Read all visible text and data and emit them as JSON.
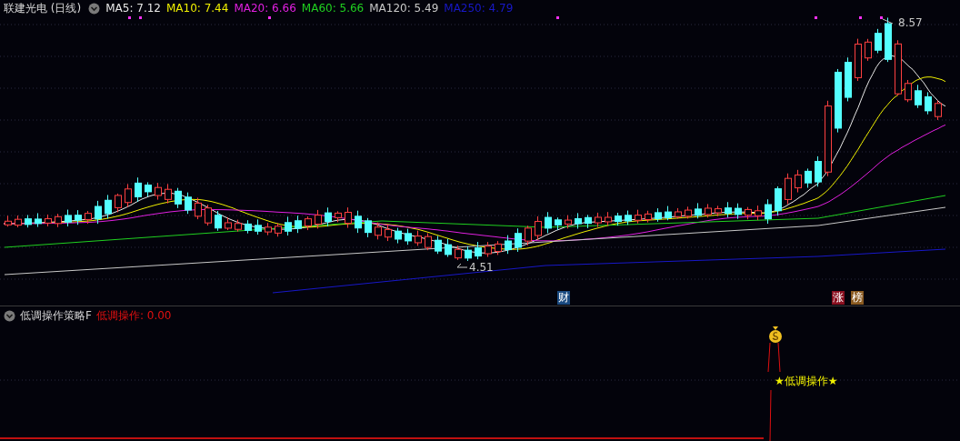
{
  "main_chart": {
    "title": "联建光电 (日线)",
    "ma_legend": [
      {
        "label": "MA5: 7.12",
        "color": "#e8e8e8"
      },
      {
        "label": "MA10: 7.44",
        "color": "#f0f000"
      },
      {
        "label": "MA20: 6.66",
        "color": "#e020e0"
      },
      {
        "label": "MA60: 5.66",
        "color": "#20d020"
      },
      {
        "label": "MA120: 5.49",
        "color": "#c8c8c8"
      },
      {
        "label": "MA250: 4.79",
        "color": "#1818c8"
      }
    ],
    "high_label": "8.57",
    "low_label": "4.51",
    "event_markers": [
      {
        "label": "财",
        "color": "#1a4a80"
      },
      {
        "label": "涨",
        "color": "#8a1020"
      },
      {
        "label": "榜",
        "color": "#8a5a20"
      }
    ]
  },
  "indicator_panel": {
    "title": "低调操作策略F",
    "value": "低调操作: 0.00",
    "signal_label": "★低调操作★"
  }
}
